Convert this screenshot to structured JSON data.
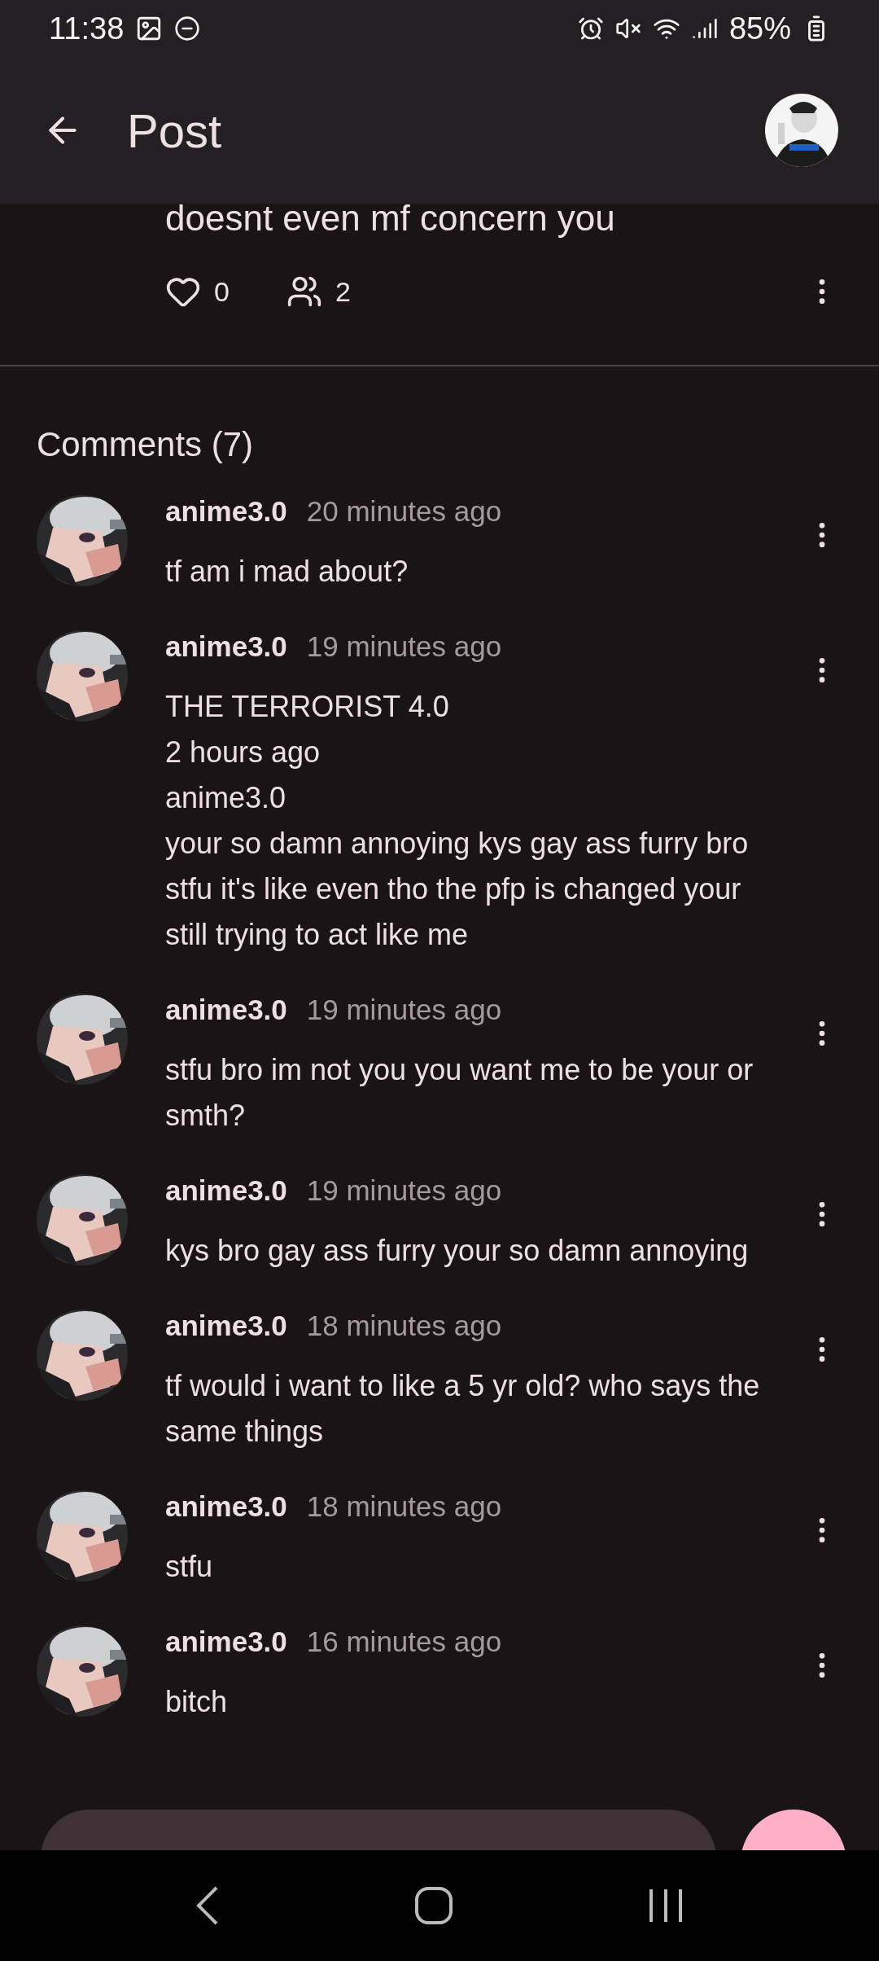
{
  "status_bar": {
    "time": "11:38",
    "battery": "85%"
  },
  "header": {
    "title": "Post"
  },
  "post": {
    "text_tail": "doesnt even mf concern you",
    "likes": "0",
    "participants": "2"
  },
  "comments_title": "Comments (7)",
  "comments": [
    {
      "author": "anime3.0",
      "time": "20 minutes ago",
      "text": "tf am i mad about?"
    },
    {
      "author": "anime3.0",
      "time": "19 minutes ago",
      "text": "THE TERRORIST 4.0\n2 hours ago\nanime3.0\nyour so damn annoying kys gay ass furry bro stfu it's like even tho the pfp is changed your still trying to act like me"
    },
    {
      "author": "anime3.0",
      "time": "19 minutes ago",
      "text": "stfu bro im not you you want me to be your or smth?"
    },
    {
      "author": "anime3.0",
      "time": "19 minutes ago",
      "text": "kys bro gay ass furry your so damn annoying"
    },
    {
      "author": "anime3.0",
      "time": "18 minutes ago",
      "text": "tf would i want to like a 5 yr old? who says the same things"
    },
    {
      "author": "anime3.0",
      "time": "18 minutes ago",
      "text": "stfu"
    },
    {
      "author": "anime3.0",
      "time": "16 minutes ago",
      "text": "bitch"
    }
  ]
}
